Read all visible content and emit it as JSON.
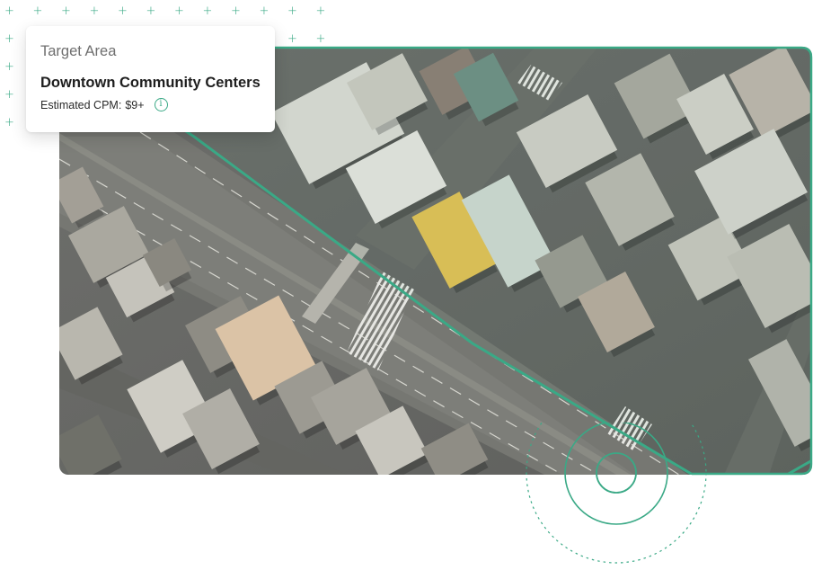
{
  "callout": {
    "label": "Target Area",
    "title": "Downtown Community Centers",
    "cpm_label": "Estimated CPM:",
    "cpm_value": "$9+",
    "info_icon": "info-icon"
  },
  "map": {
    "kind": "aerial-photo",
    "highlight_color": "#3aa986"
  },
  "decor": {
    "plus_icon": "plus-icon",
    "accent": "#3aa986"
  }
}
